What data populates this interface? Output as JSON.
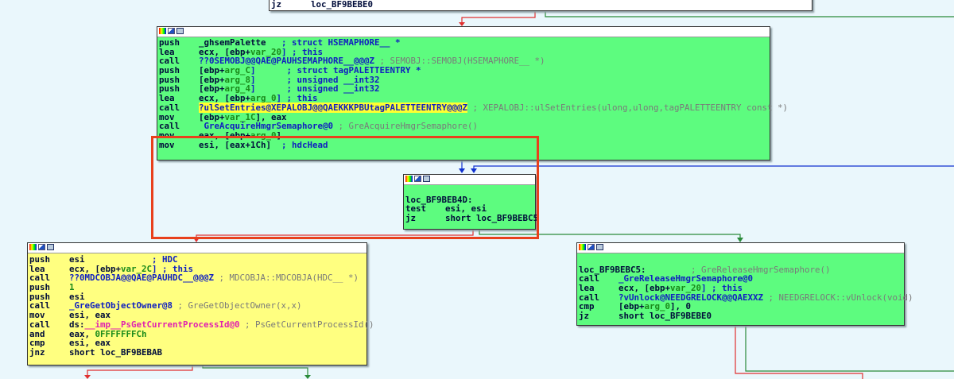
{
  "colors": {
    "edge_true": "#e03030",
    "edge_false": "#2a8a3a",
    "edge_jump": "#1030d0",
    "highlight_box": "#e8401c",
    "block_green": "#5dfc7f",
    "block_yellow": "#ffff80"
  },
  "blocks": [
    {
      "id": "top",
      "lines": [
        [
          {
            "t": "jz",
            "c": "mn"
          },
          {
            "t": "loc_BF9BEBE0",
            "c": "op"
          }
        ]
      ]
    },
    {
      "id": "semaphore",
      "lines": [
        [
          {
            "t": "push",
            "c": "mn"
          },
          {
            "t": "_ghsemPalette   ",
            "c": "op"
          },
          {
            "t": "; struct HSEMAPHORE__ *",
            "c": "t-cmtb"
          }
        ],
        [
          {
            "t": "lea",
            "c": "mn"
          },
          {
            "t": "ecx, [ebp+",
            "c": "op"
          },
          {
            "t": "var_20",
            "c": "t-var"
          },
          {
            "t": "] ; this",
            "c": "t-cmtb"
          }
        ],
        [
          {
            "t": "call",
            "c": "mn"
          },
          {
            "t": "??0SEMOBJ@@QAE@PAUHSEMAPHORE__@@@Z",
            "c": "op t-name"
          },
          {
            "t": " ; SEMOBJ::SEMOBJ(HSEMAPHORE__ *)",
            "c": "t-cmt"
          }
        ],
        [
          {
            "t": "push",
            "c": "mn"
          },
          {
            "t": "[ebp+",
            "c": "op"
          },
          {
            "t": "arg_C",
            "c": "t-var"
          },
          {
            "t": "]      ; struct tagPALETTEENTRY *",
            "c": "t-cmtb"
          }
        ],
        [
          {
            "t": "push",
            "c": "mn"
          },
          {
            "t": "[ebp+",
            "c": "op"
          },
          {
            "t": "arg_8",
            "c": "t-var"
          },
          {
            "t": "]      ; unsigned __int32",
            "c": "t-cmtb"
          }
        ],
        [
          {
            "t": "push",
            "c": "mn"
          },
          {
            "t": "[ebp+",
            "c": "op"
          },
          {
            "t": "arg_4",
            "c": "t-var"
          },
          {
            "t": "]      ; unsigned __int32",
            "c": "t-cmtb"
          }
        ],
        [
          {
            "t": "lea",
            "c": "mn"
          },
          {
            "t": "ecx, [ebp+",
            "c": "op"
          },
          {
            "t": "arg_0",
            "c": "t-var"
          },
          {
            "t": "] ; this",
            "c": "t-cmtb"
          }
        ],
        [
          {
            "t": "call",
            "c": "mn"
          },
          {
            "t": "?ulSetEntries@XEPALOBJ@@QAEKKKPBUtagPALETTEENTRY@@@Z",
            "c": "op t-hl"
          },
          {
            "t": " ; XEPALOBJ::ulSetEntries(ulong,ulong,tagPALETTEENTRY const *)",
            "c": "t-cmt"
          }
        ],
        [
          {
            "t": "mov",
            "c": "mn"
          },
          {
            "t": "[ebp+",
            "c": "op"
          },
          {
            "t": "var_1C",
            "c": "t-var"
          },
          {
            "t": "], eax",
            "c": ""
          }
        ],
        [
          {
            "t": "call",
            "c": "mn"
          },
          {
            "t": " GreAcquireHmgrSemaphore@0",
            "c": "op t-name"
          },
          {
            "t": " ; GreAcquireHmgrSemaphore()",
            "c": "t-cmt"
          }
        ],
        [
          {
            "t": "mov",
            "c": "mn"
          },
          {
            "t": "eax, [ebp+",
            "c": "op"
          },
          {
            "t": "arg_0",
            "c": "t-var"
          },
          {
            "t": "]",
            "c": ""
          }
        ],
        [
          {
            "t": "mov",
            "c": "mn"
          },
          {
            "t": "esi, [eax+1Ch]  ",
            "c": "op"
          },
          {
            "t": "; hdcHead",
            "c": "t-cmtb"
          }
        ]
      ]
    },
    {
      "id": "loc_BF9BEB4D",
      "lines": [
        [],
        [
          {
            "t": "loc_BF9BEB4D:",
            "c": "mn"
          }
        ],
        [
          {
            "t": "test",
            "c": "mn"
          },
          {
            "t": "esi, esi",
            "c": "op"
          }
        ],
        [
          {
            "t": "jz",
            "c": "mn"
          },
          {
            "t": "short loc_BF9BEBC5",
            "c": "op"
          }
        ]
      ]
    },
    {
      "id": "mdcobja",
      "lines": [
        [
          {
            "t": "push",
            "c": "mn"
          },
          {
            "t": "esi             ",
            "c": "op"
          },
          {
            "t": "; HDC",
            "c": "t-cmtb"
          }
        ],
        [
          {
            "t": "lea",
            "c": "mn"
          },
          {
            "t": "ecx, [ebp+",
            "c": "op"
          },
          {
            "t": "var_2C",
            "c": "t-var"
          },
          {
            "t": "] ; this",
            "c": "t-cmtb"
          }
        ],
        [
          {
            "t": "call",
            "c": "mn"
          },
          {
            "t": "??0MDCOBJA@@QAE@PAUHDC__@@@Z",
            "c": "op t-name"
          },
          {
            "t": " ; MDCOBJA::MDCOBJA(HDC__ *)",
            "c": "t-cmt"
          }
        ],
        [
          {
            "t": "push",
            "c": "mn"
          },
          {
            "t": "1",
            "c": "op t-num"
          }
        ],
        [
          {
            "t": "push",
            "c": "mn"
          },
          {
            "t": "esi",
            "c": "op"
          }
        ],
        [
          {
            "t": "call",
            "c": "mn"
          },
          {
            "t": "_GreGetObjectOwner@8",
            "c": "op t-name"
          },
          {
            "t": " ; GreGetObjectOwner(x,x)",
            "c": "t-cmt"
          }
        ],
        [
          {
            "t": "mov",
            "c": "mn"
          },
          {
            "t": "esi, eax",
            "c": "op"
          }
        ],
        [
          {
            "t": "call",
            "c": "mn"
          },
          {
            "t": "ds:",
            "c": "op"
          },
          {
            "t": "__imp__PsGetCurrentProcessId@0",
            "c": "t-imp"
          },
          {
            "t": " ; PsGetCurrentProcessId()",
            "c": "t-cmt"
          }
        ],
        [
          {
            "t": "and",
            "c": "mn"
          },
          {
            "t": "eax, ",
            "c": "op"
          },
          {
            "t": "0FFFFFFFCh",
            "c": "t-num"
          }
        ],
        [
          {
            "t": "cmp",
            "c": "mn"
          },
          {
            "t": "esi, eax",
            "c": "op"
          }
        ],
        [
          {
            "t": "jnz",
            "c": "mn"
          },
          {
            "t": "short loc_BF9BEBAB",
            "c": "op"
          }
        ]
      ]
    },
    {
      "id": "loc_BF9BEBC5",
      "lines": [
        [],
        [
          {
            "t": "loc_BF9BEBC5:",
            "c": "mn"
          },
          {
            "t": "              ",
            "c": "op"
          },
          {
            "t": "; GreReleaseHmgrSemaphore()",
            "c": "t-cmt"
          }
        ],
        [
          {
            "t": "call",
            "c": "mn"
          },
          {
            "t": "_GreReleaseHmgrSemaphore@0",
            "c": "op t-name"
          }
        ],
        [
          {
            "t": "lea",
            "c": "mn"
          },
          {
            "t": "ecx, [ebp+",
            "c": "op"
          },
          {
            "t": "var_20",
            "c": "t-var"
          },
          {
            "t": "] ; this",
            "c": "t-cmtb"
          }
        ],
        [
          {
            "t": "call",
            "c": "mn"
          },
          {
            "t": "?vUnlock@NEEDGRELOCK@@QAEXXZ",
            "c": "op t-name"
          },
          {
            "t": " ; NEEDGRELOCK::vUnlock(void)",
            "c": "t-cmt"
          }
        ],
        [
          {
            "t": "cmp",
            "c": "mn"
          },
          {
            "t": "[ebp+",
            "c": "op"
          },
          {
            "t": "arg_0",
            "c": "t-var"
          },
          {
            "t": "], 0",
            "c": ""
          }
        ],
        [
          {
            "t": "jz",
            "c": "mn"
          },
          {
            "t": "short loc_BF9BEBE0",
            "c": "op"
          }
        ]
      ]
    }
  ]
}
